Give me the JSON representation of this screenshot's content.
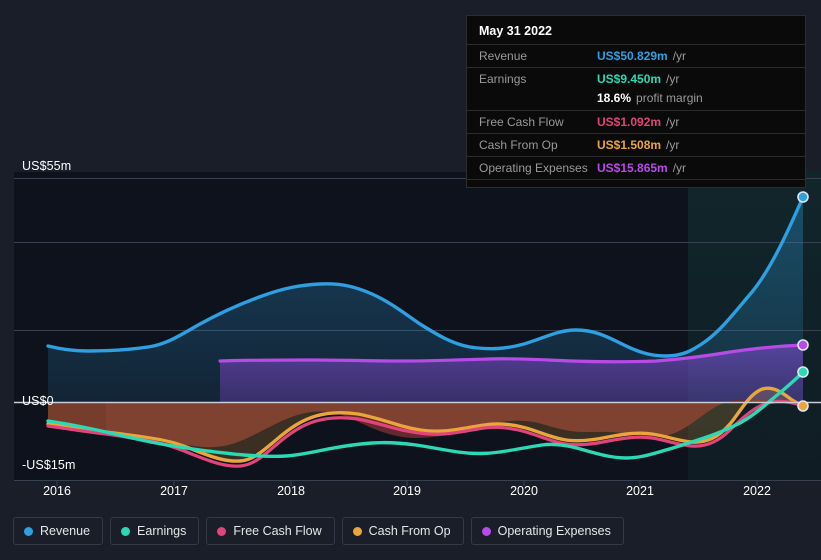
{
  "background_color": "#191e29",
  "tooltip": {
    "title": "May 31 2022",
    "rows": [
      {
        "label": "Revenue",
        "value": "US$50.829m",
        "unit": "/yr",
        "color": "#2e9fe0"
      },
      {
        "label": "Earnings",
        "value": "US$9.450m",
        "unit": "/yr",
        "color": "#2bd9b4"
      },
      {
        "label": "Free Cash Flow",
        "value": "US$1.092m",
        "unit": "/yr",
        "color": "#e0447a"
      },
      {
        "label": "Cash From Op",
        "value": "US$1.508m",
        "unit": "/yr",
        "color": "#eaa63b"
      },
      {
        "label": "Operating Expenses",
        "value": "US$15.865m",
        "unit": "/yr",
        "color": "#b84ae8"
      }
    ],
    "sub_row": {
      "value": "18.6%",
      "text": "profit margin"
    }
  },
  "legend": {
    "items": [
      {
        "label": "Revenue",
        "color": "#2e9fe0"
      },
      {
        "label": "Earnings",
        "color": "#2bd9b4"
      },
      {
        "label": "Free Cash Flow",
        "color": "#e0447a"
      },
      {
        "label": "Cash From Op",
        "color": "#eaa63b"
      },
      {
        "label": "Operating Expenses",
        "color": "#b84ae8"
      }
    ]
  },
  "chart_data": {
    "type": "area",
    "title": "",
    "xlabel": "",
    "ylabel": "US$",
    "ylim": [
      -15,
      55
    ],
    "y_ticks": [
      "US$55m",
      "US$0",
      "-US$15m"
    ],
    "y_tick_values": [
      55,
      0,
      -15
    ],
    "grid": true,
    "legend_position": "bottom",
    "x_tick_labels": [
      "2016",
      "2017",
      "2018",
      "2019",
      "2020",
      "2021",
      "2022"
    ],
    "x_tick_values": [
      2016,
      2017,
      2018,
      2019,
      2020,
      2021,
      2022
    ],
    "x": [
      2015.93,
      2016.2,
      2016.45,
      2016.7,
      2016.95,
      2017.2,
      2017.45,
      2017.7,
      2017.95,
      2018.2,
      2018.45,
      2018.7,
      2018.95,
      2019.2,
      2019.45,
      2019.7,
      2019.95,
      2020.2,
      2020.45,
      2020.7,
      2020.95,
      2021.2,
      2021.45,
      2021.7,
      2021.95,
      2022.2,
      2022.42
    ],
    "series": [
      {
        "name": "Revenue",
        "color": "#2e9fe0",
        "values": [
          13.8,
          13.2,
          12.9,
          12.9,
          13.2,
          16.2,
          19.4,
          22.6,
          25.0,
          27.5,
          28.8,
          28.2,
          26.6,
          24.2,
          20.8,
          20.2,
          20.2,
          22.2,
          23.2,
          21.0,
          17.8,
          15.6,
          15.3,
          17.8,
          22.5,
          32.0,
          50.829
        ],
        "endpoint_value": 50.829
      },
      {
        "name": "Earnings",
        "color": "#2bd9b4",
        "values": [
          -2.4,
          -3.2,
          -4.2,
          -5.2,
          -5.8,
          -6.1,
          -6.4,
          -6.9,
          -7.6,
          -7.6,
          -6.6,
          -5.0,
          -3.6,
          -3.1,
          -3.4,
          -4.3,
          -5.2,
          -5.6,
          -5.1,
          -4.0,
          -2.6,
          -4.2,
          -5.4,
          -4.8,
          -3.2,
          1.2,
          9.45
        ],
        "endpoint_value": 9.45
      },
      {
        "name": "Free Cash Flow",
        "color": "#e0447a",
        "values": [
          -2.9,
          -3.4,
          -3.9,
          -4.5,
          -5.2,
          -5.4,
          -6.4,
          -9.2,
          -10.9,
          -9.4,
          -6.8,
          -4.7,
          -3.2,
          -2.6,
          -2.8,
          -3.6,
          -4.4,
          -4.8,
          -4.6,
          -4.4,
          -4.2,
          -5.6,
          -6.5,
          -5.2,
          -3.6,
          -1.2,
          1.092
        ],
        "endpoint_value": 1.092
      },
      {
        "name": "Cash From Op",
        "color": "#eaa63b",
        "values": [
          -2.6,
          -3.1,
          -3.6,
          -4.2,
          -4.9,
          -5.0,
          -6.0,
          -8.8,
          -10.5,
          -9.0,
          -6.4,
          -4.3,
          -2.8,
          -2.2,
          -2.4,
          -3.2,
          -4.0,
          -4.4,
          -4.2,
          -4.0,
          -3.8,
          -5.2,
          -6.1,
          -4.8,
          -3.0,
          2.9,
          1.508
        ],
        "endpoint_value": 1.508
      },
      {
        "name": "Operating Expenses",
        "color": "#b84ae8",
        "start_x": 2017.2,
        "values": [
          null,
          null,
          null,
          null,
          null,
          10.0,
          10.1,
          10.1,
          10.2,
          10.2,
          10.1,
          10.0,
          10.0,
          10.0,
          10.0,
          10.1,
          10.2,
          10.4,
          10.3,
          10.1,
          9.9,
          9.8,
          9.9,
          10.3,
          11.2,
          12.8,
          15.865
        ],
        "endpoint_value": 15.865
      }
    ],
    "highlight_region": {
      "from_x": 2021.6,
      "to_x": 2022.42
    }
  }
}
